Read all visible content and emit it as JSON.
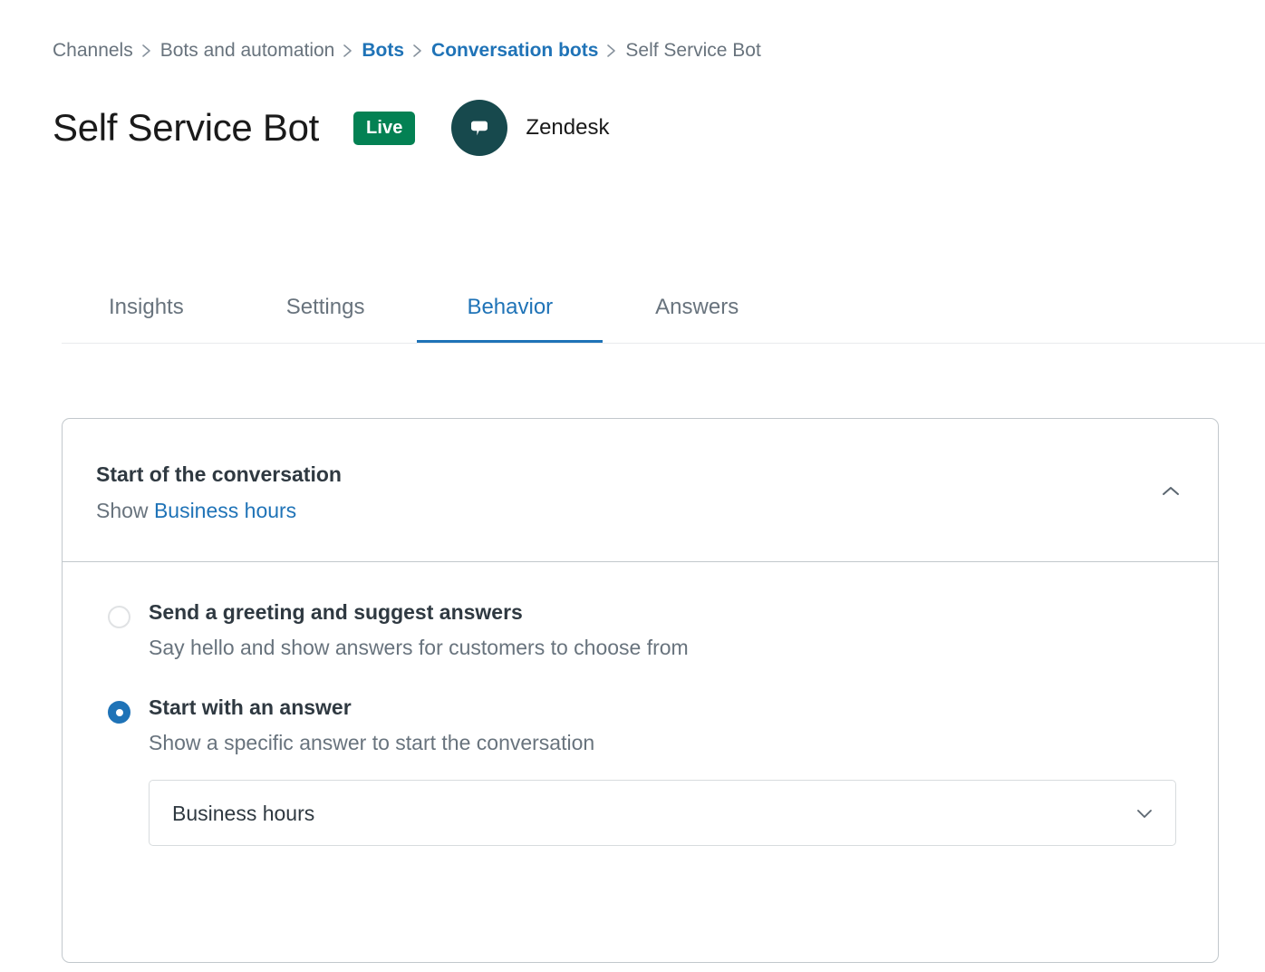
{
  "breadcrumb": {
    "separator": "chevron-right-icon",
    "items": [
      {
        "label": "Channels",
        "style": "plain"
      },
      {
        "label": "Bots and automation",
        "style": "plain"
      },
      {
        "label": "Bots",
        "style": "link"
      },
      {
        "label": "Conversation bots",
        "style": "link"
      },
      {
        "label": "Self Service Bot",
        "style": "current"
      }
    ]
  },
  "header": {
    "title": "Self Service Bot",
    "status_badge": "Live",
    "status_badge_color": "#038153",
    "brand_name": "Zendesk",
    "brand_logo_icon": "zendesk-chat-bubble-icon",
    "brand_logo_color": "#17494D"
  },
  "tabs": {
    "active_color": "#1F73B7",
    "items": [
      {
        "label": "Insights",
        "active": false
      },
      {
        "label": "Settings",
        "active": false
      },
      {
        "label": "Behavior",
        "active": true
      },
      {
        "label": "Answers",
        "active": false
      }
    ]
  },
  "card": {
    "title": "Start of the conversation",
    "subtitle_prefix": "Show",
    "subtitle_link": "Business hours",
    "collapse_icon": "chevron-up-icon",
    "options": [
      {
        "title": "Send a greeting and suggest answers",
        "description": "Say hello and show answers for customers to choose from",
        "selected": false
      },
      {
        "title": "Start with an answer",
        "description": "Show a specific answer to start the conversation",
        "selected": true
      }
    ],
    "select": {
      "value": "Business hours",
      "chevron_icon": "chevron-down-icon"
    }
  }
}
